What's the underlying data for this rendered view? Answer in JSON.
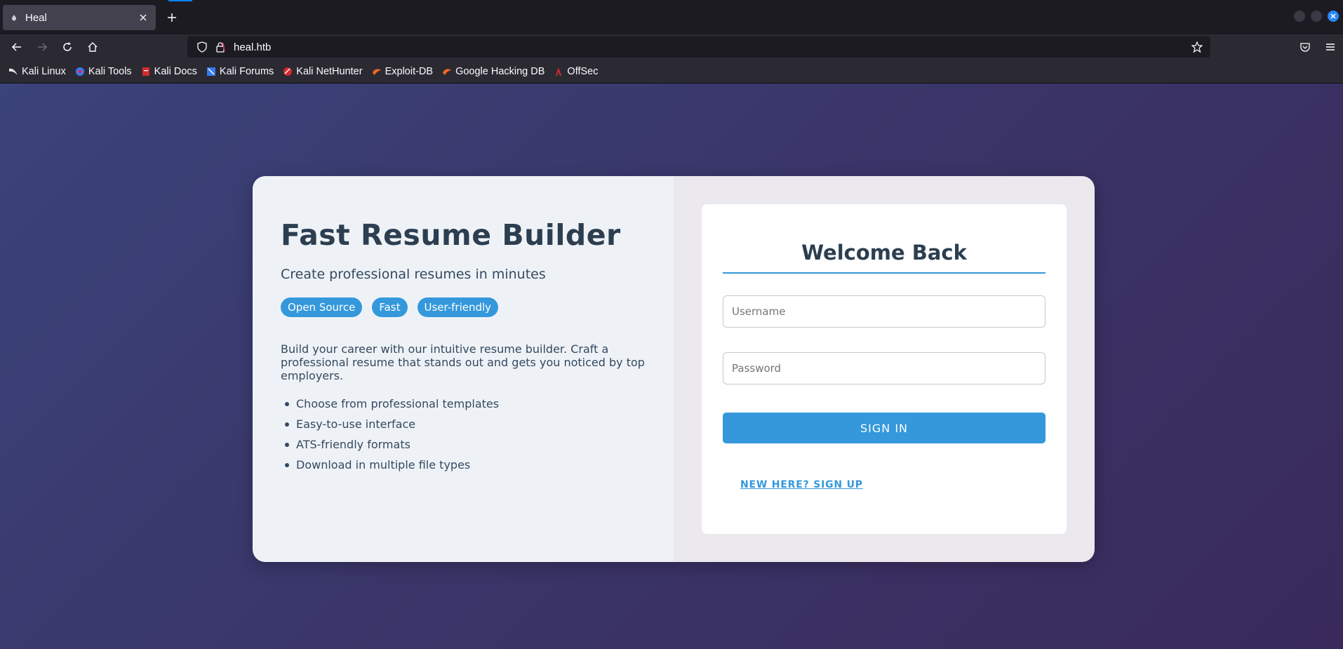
{
  "browser": {
    "tab": {
      "title": "Heal",
      "close_icon": "close-icon"
    },
    "url": "heal.htb",
    "bookmarks": [
      {
        "label": "Kali Linux",
        "icon": "kali-dragon-icon",
        "color": "#e6e6e6"
      },
      {
        "label": "Kali Tools",
        "icon": "kali-tools-icon",
        "color": "#367bf0"
      },
      {
        "label": "Kali Docs",
        "icon": "kali-docs-icon",
        "color": "#d42a2a"
      },
      {
        "label": "Kali Forums",
        "icon": "kali-forums-icon",
        "color": "#367bf0"
      },
      {
        "label": "Kali NetHunter",
        "icon": "nethunter-icon",
        "color": "#d42a2a"
      },
      {
        "label": "Exploit-DB",
        "icon": "exploit-db-icon",
        "color": "#f26822"
      },
      {
        "label": "Google Hacking DB",
        "icon": "ghdb-icon",
        "color": "#f26822"
      },
      {
        "label": "OffSec",
        "icon": "offsec-icon",
        "color": "#d42a2a"
      }
    ]
  },
  "page": {
    "hero": {
      "title": "Fast Resume Builder",
      "subtitle": "Create professional resumes in minutes",
      "tags": [
        "Open Source",
        "Fast",
        "User-friendly"
      ],
      "description": "Build your career with our intuitive resume builder. Craft a professional resume that stands out and gets you noticed by top employers.",
      "features": [
        "Choose from professional templates",
        "Easy-to-use interface",
        "ATS-friendly formats",
        "Download in multiple file types"
      ]
    },
    "login": {
      "title": "Welcome Back",
      "username_placeholder": "Username",
      "password_placeholder": "Password",
      "signin_label": "SIGN IN",
      "signup_label": "NEW HERE? SIGN UP"
    }
  },
  "colors": {
    "accent": "#3498db",
    "heading": "#2c3e50",
    "text": "#34495e"
  }
}
